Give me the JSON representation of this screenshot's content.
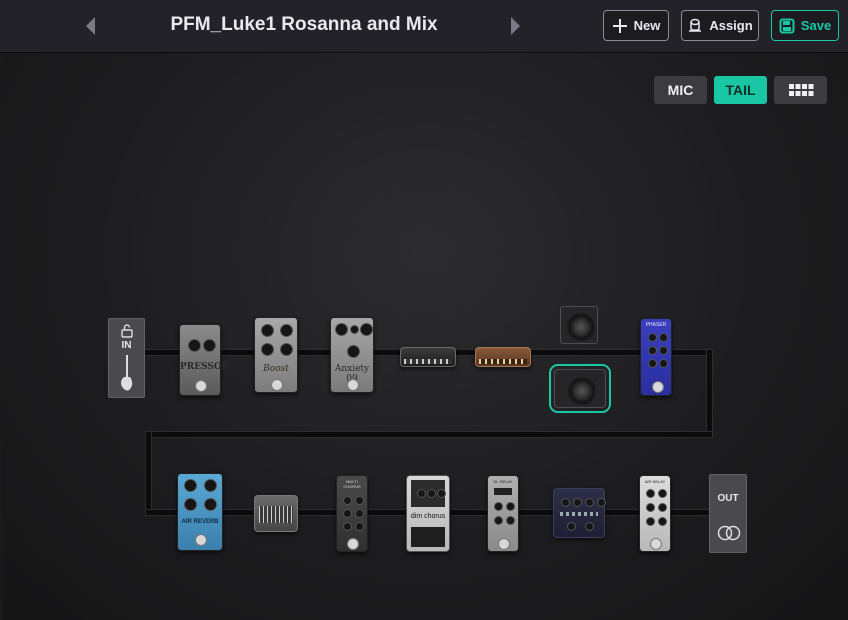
{
  "header": {
    "preset_name": "PFM_Luke1 Rosanna and Mix",
    "new_label": "New",
    "assign_label": "Assign",
    "save_label": "Save"
  },
  "view_controls": {
    "mic_label": "MIC",
    "tail_label": "TAIL",
    "grid_icon": "grid-icon",
    "active": "TAIL"
  },
  "chain": {
    "input_label": "IN",
    "output_label": "OUT",
    "blocks_row1": [
      {
        "name": "compressor-pedal",
        "text": "PRESSOR"
      },
      {
        "name": "boost-pedal",
        "text": "Boost"
      },
      {
        "name": "overdrive-pedal",
        "text": "Anxiety 09"
      },
      {
        "name": "amp-head-1",
        "text": ""
      },
      {
        "name": "amp-head-2",
        "text": ""
      },
      {
        "name": "cabinet-1",
        "text": ""
      },
      {
        "name": "cabinet-2",
        "text": ""
      },
      {
        "name": "phaser-pedal",
        "text": "PHASER"
      }
    ],
    "blocks_row2": [
      {
        "name": "reverb-pedal",
        "text": "AIR REVERB"
      },
      {
        "name": "eq-rack",
        "text": ""
      },
      {
        "name": "multi-chorus-pedal",
        "text": "MULTI CHORUS"
      },
      {
        "name": "chorus-pedal",
        "text": "dim chorus"
      },
      {
        "name": "delay-pedal",
        "text": "DL DELAY"
      },
      {
        "name": "rack-unit",
        "text": ""
      },
      {
        "name": "air-delay-pedal",
        "text": "AIR DELAY"
      }
    ]
  },
  "colors": {
    "accent": "#19c7a4",
    "background": "#1a1a1c",
    "toolbar": "#222228"
  }
}
